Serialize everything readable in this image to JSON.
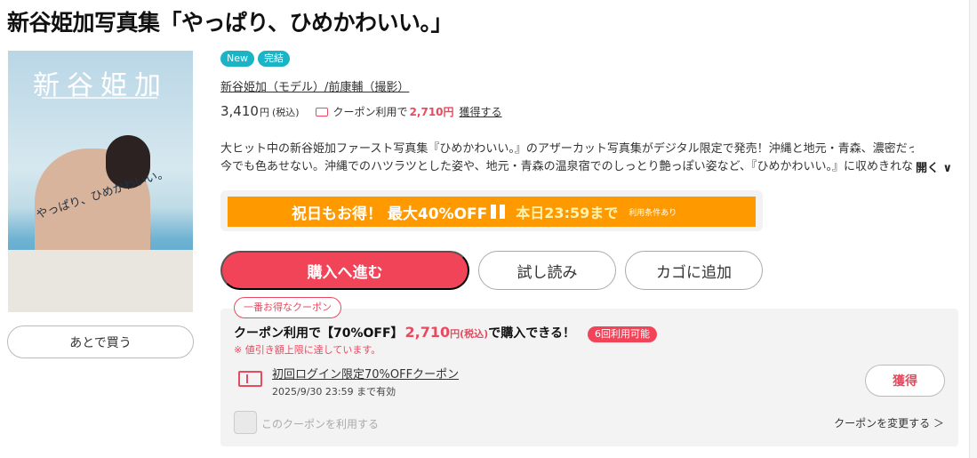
{
  "product": {
    "title": "新谷姫加写真集「やっぱり、ひめかわいい。」",
    "badges": [
      "New",
      "完結"
    ],
    "authors": "新谷姫加（モデル）/前康輔（撮影）",
    "price": "3,410",
    "price_unit": "円",
    "price_tax": "(税込)",
    "coupon_price_label": "クーポン利用で",
    "coupon_price": "2,710円",
    "coupon_get_link": "獲得する",
    "description_line1": "大ヒット中の新谷姫加ファースト写真集『ひめかわいい。』のアザーカット写真集がデジタル限定で発売！沖縄と地元・青森、濃密だった撮影は",
    "description_line2": "今でも色あせない。沖縄でのハツラツとした姿や、地元・青森の温泉宿でのしっとり艶っぽい姿など、『ひめかわいい。』に収めきれなか",
    "open_label": "開く ∨"
  },
  "cover": {
    "title": "新谷姫加",
    "handwriting": "やっぱり、ひめかわいい。"
  },
  "later_button": "あとで買う",
  "promo": {
    "main": "祝日もお得！ 最大40%OFF",
    "until": "本日23:59まで",
    "terms": "利用条件あり",
    "color": "#ff9900"
  },
  "actions": {
    "buy": "購入へ進む",
    "trial": "試し読み",
    "cart": "カゴに追加"
  },
  "coupon": {
    "best_tag": "一番お得なクーポン",
    "head_prefix": "クーポン利用で【70%OFF】",
    "head_price": "2,710",
    "head_unit": "円(税込)",
    "head_suffix": "で購入できる！",
    "uses": "6回利用可能",
    "note": "※ 値引き額上限に達しています。",
    "name": "初回ログイン限定70%OFFクーポン",
    "expiry": "2025/9/30 23:59 まで有効",
    "get_button": "獲得",
    "use_label": "このクーポンを利用する",
    "change_label": "クーポンを変更する ＞"
  },
  "colors": {
    "accent": "#f24459",
    "badge": "#1ab4c6"
  }
}
